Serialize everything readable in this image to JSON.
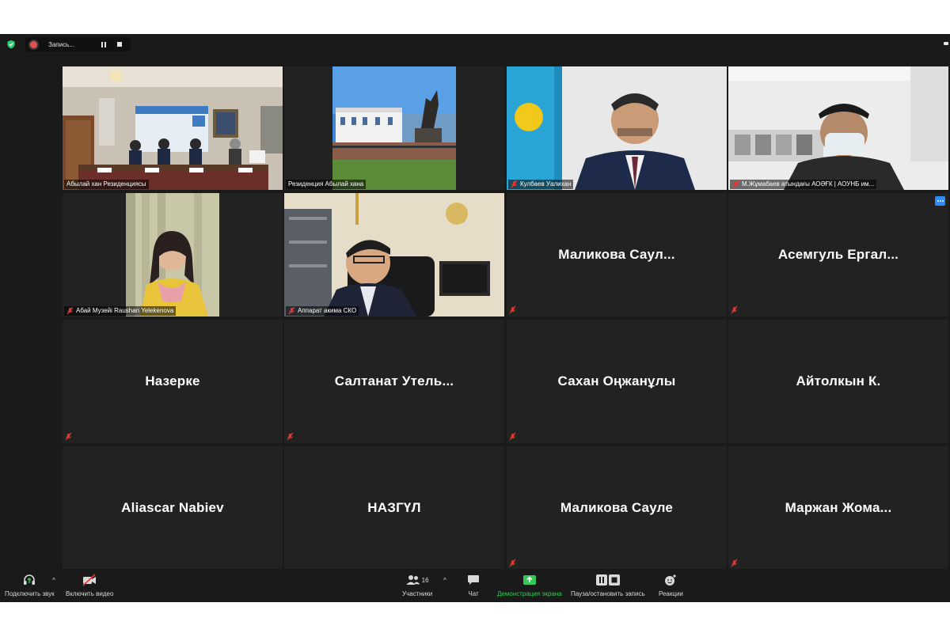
{
  "recording": {
    "label": "Запись..."
  },
  "tiles": [
    {
      "label": "Абылай хан Резиденциясы",
      "muted": false,
      "active": true
    },
    {
      "label": "Резиденция Абылай хана",
      "muted": false
    },
    {
      "label": "Кулбаев Уалихан",
      "muted": true
    },
    {
      "label": "М.Жұмабаев атындағы АОӘҒК | АОУНБ им...",
      "muted": true
    },
    {
      "label": "Абай Музейі Raushan Yelekenova",
      "muted": true
    },
    {
      "label": "Аппарат акима СКО",
      "muted": true
    },
    {
      "name": "Маликова  Саул...",
      "muted": true
    },
    {
      "name": "Асемгуль  Ергал...",
      "muted": true
    },
    {
      "name": "Назерке",
      "muted": true
    },
    {
      "name": "Салтанат  Утель...",
      "muted": true
    },
    {
      "name": "Сахан Оңжанұлы",
      "muted": true
    },
    {
      "name": "Айтолкын К.",
      "muted": false
    },
    {
      "name": "Aliascar Nabiev",
      "muted": false
    },
    {
      "name": "НАЗГҮЛ",
      "muted": false
    },
    {
      "name": "Маликова Сауле",
      "muted": true
    },
    {
      "name": "Маржан  Жома...",
      "muted": true
    }
  ],
  "toolbar": {
    "audio": "Подключить звук",
    "video": "Включить видео",
    "participants": "Участники",
    "participants_count": "16",
    "chat": "Чат",
    "share": "Демонстрация экрана",
    "record": "Пауза/остановить запись",
    "reactions": "Реакции"
  },
  "colors": {
    "active_border": "#d4e157",
    "share_green": "#35c759",
    "accent_blue": "#2d8cff"
  }
}
